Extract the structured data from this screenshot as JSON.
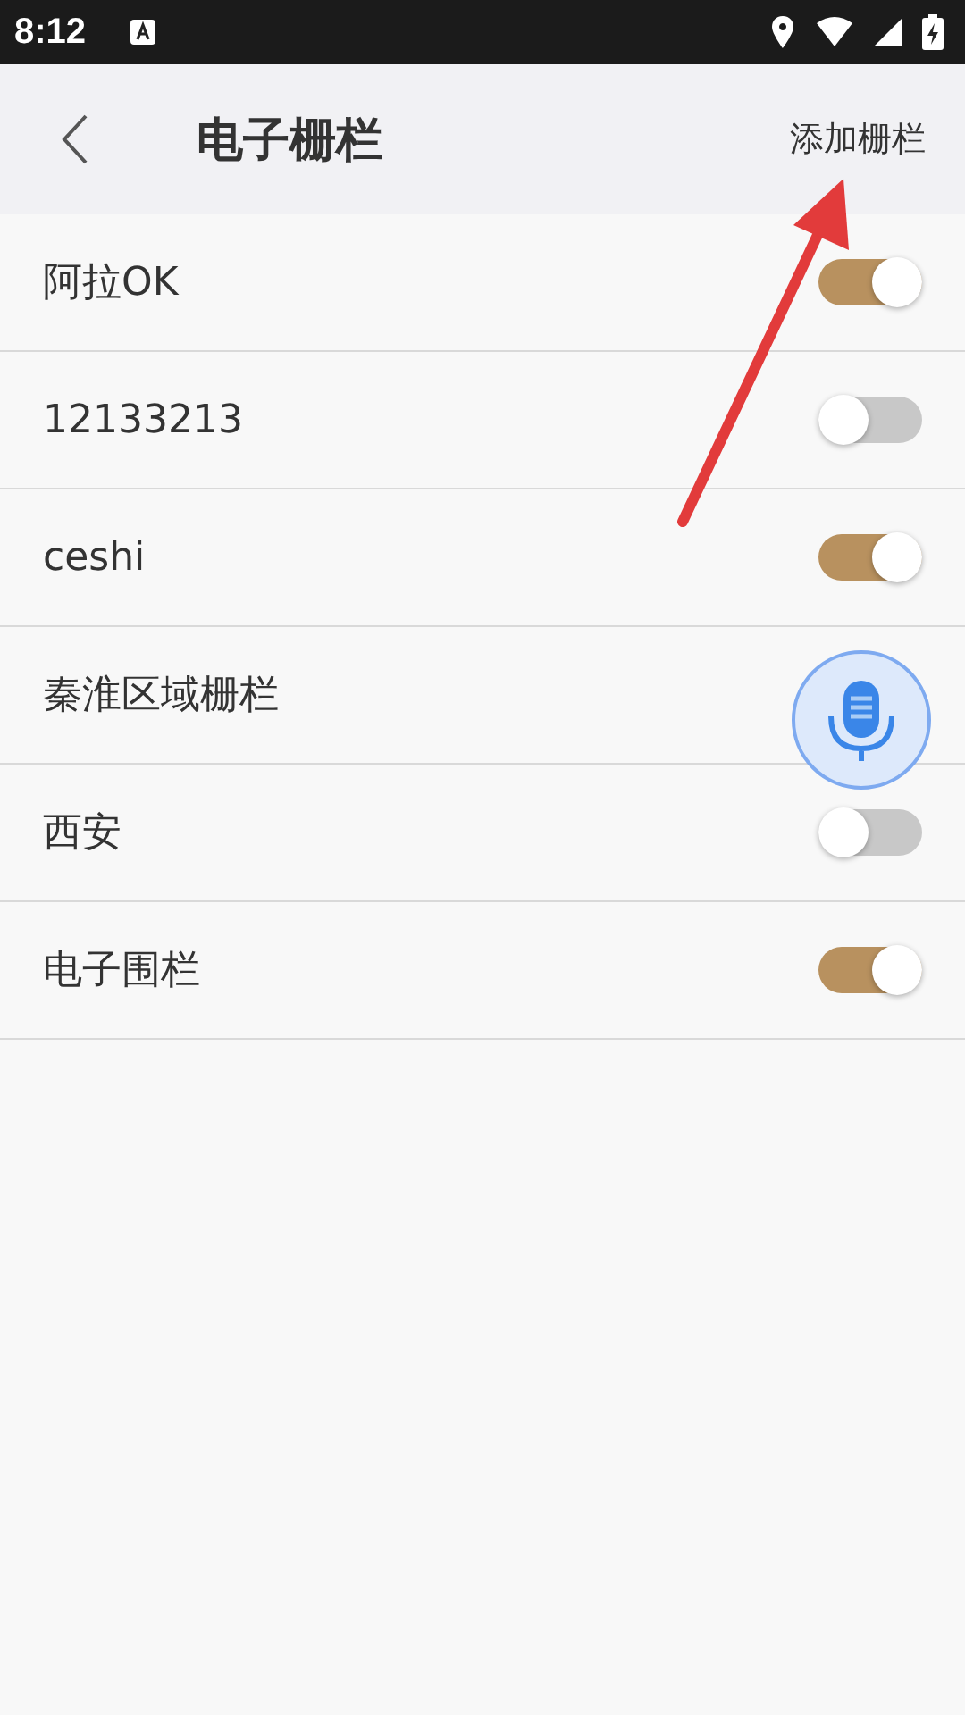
{
  "status_bar": {
    "time": "8:12"
  },
  "header": {
    "title": "电子栅栏",
    "action": "添加栅栏"
  },
  "fences": [
    {
      "name": "阿拉OK",
      "on": true
    },
    {
      "name": "12133213",
      "on": false
    },
    {
      "name": "ceshi",
      "on": true
    },
    {
      "name": "秦淮区域栅栏"
    },
    {
      "name": "西安",
      "on": false
    },
    {
      "name": "电子围栏",
      "on": true
    }
  ]
}
